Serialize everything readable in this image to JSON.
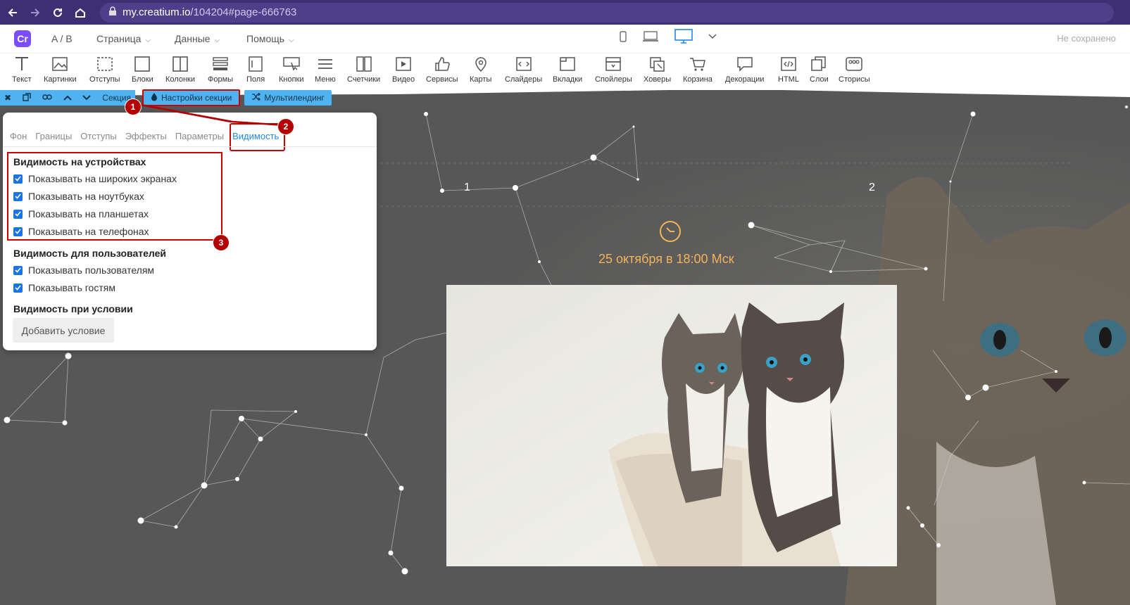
{
  "browser": {
    "url_domain": "my.creatium.io",
    "url_path": "/104204#page-666763"
  },
  "header": {
    "logo_text": "Cr",
    "menu": [
      {
        "label": "A / B",
        "has_dropdown": false
      },
      {
        "label": "Страница",
        "has_dropdown": true
      },
      {
        "label": "Данные",
        "has_dropdown": true
      },
      {
        "label": "Помощь",
        "has_dropdown": true
      }
    ],
    "devices": [
      "phone-icon",
      "laptop-icon",
      "desktop-icon"
    ],
    "active_device": "desktop-icon",
    "status": "Не сохранено"
  },
  "toolbar": {
    "items": [
      {
        "label": "Текст",
        "icon": "text-icon"
      },
      {
        "label": "Картинки",
        "icon": "image-icon"
      },
      {
        "label": "Отступы",
        "icon": "spacing-icon"
      },
      {
        "label": "Блоки",
        "icon": "block-icon"
      },
      {
        "label": "Колонки",
        "icon": "columns-icon"
      },
      {
        "label": "Формы",
        "icon": "form-icon"
      },
      {
        "label": "Поля",
        "icon": "field-icon"
      },
      {
        "label": "Кнопки",
        "icon": "button-icon"
      },
      {
        "label": "Меню",
        "icon": "menu-icon"
      },
      {
        "label": "Счетчики",
        "icon": "counter-icon"
      },
      {
        "label": "Видео",
        "icon": "video-icon"
      },
      {
        "label": "Сервисы",
        "icon": "services-icon"
      },
      {
        "label": "Карты",
        "icon": "map-icon"
      },
      {
        "label": "Слайдеры",
        "icon": "slider-icon"
      },
      {
        "label": "Вкладки",
        "icon": "tabs-icon"
      },
      {
        "label": "Спойлеры",
        "icon": "spoiler-icon"
      },
      {
        "label": "Ховеры",
        "icon": "hover-icon"
      },
      {
        "label": "Корзина",
        "icon": "cart-icon"
      },
      {
        "label": "Декорации",
        "icon": "decor-icon"
      },
      {
        "label": "HTML",
        "icon": "html-icon"
      },
      {
        "label": "Слои",
        "icon": "layers-icon"
      },
      {
        "label": "Сторисы",
        "icon": "stories-icon"
      }
    ]
  },
  "section_bar": {
    "section_label": "Секция",
    "settings_label": "Настройки секции",
    "multilanding_label": "Мультилендинг"
  },
  "popup": {
    "tabs": [
      {
        "label": "Фон",
        "active": false
      },
      {
        "label": "Границы",
        "active": false
      },
      {
        "label": "Отступы",
        "active": false
      },
      {
        "label": "Эффекты",
        "active": false
      },
      {
        "label": "Параметры",
        "active": false
      },
      {
        "label": "Видимость",
        "active": true
      }
    ],
    "devices_title": "Видимость на устройствах",
    "devices_options": [
      {
        "label": "Показывать на широких экранах",
        "checked": true
      },
      {
        "label": "Показывать на ноутбуках",
        "checked": true
      },
      {
        "label": "Показывать на планшетах",
        "checked": true
      },
      {
        "label": "Показывать на телефонах",
        "checked": true
      }
    ],
    "users_title": "Видимость для пользователей",
    "users_options": [
      {
        "label": "Показывать пользователям",
        "checked": true
      },
      {
        "label": "Показывать гостям",
        "checked": true
      }
    ],
    "condition_title": "Видимость при условии",
    "add_condition_label": "Добавить условие"
  },
  "badges": [
    "1",
    "2",
    "3"
  ],
  "page": {
    "label_1": "1",
    "label_2": "2",
    "event_date": "25 октября в 18:00 Мск"
  },
  "colors": {
    "browser_bar": "#3c2f73",
    "accent_blue": "#4fb3f2",
    "highlight_red": "#c00000",
    "date_orange": "#f3b35a",
    "canvas_bg": "#575757"
  }
}
